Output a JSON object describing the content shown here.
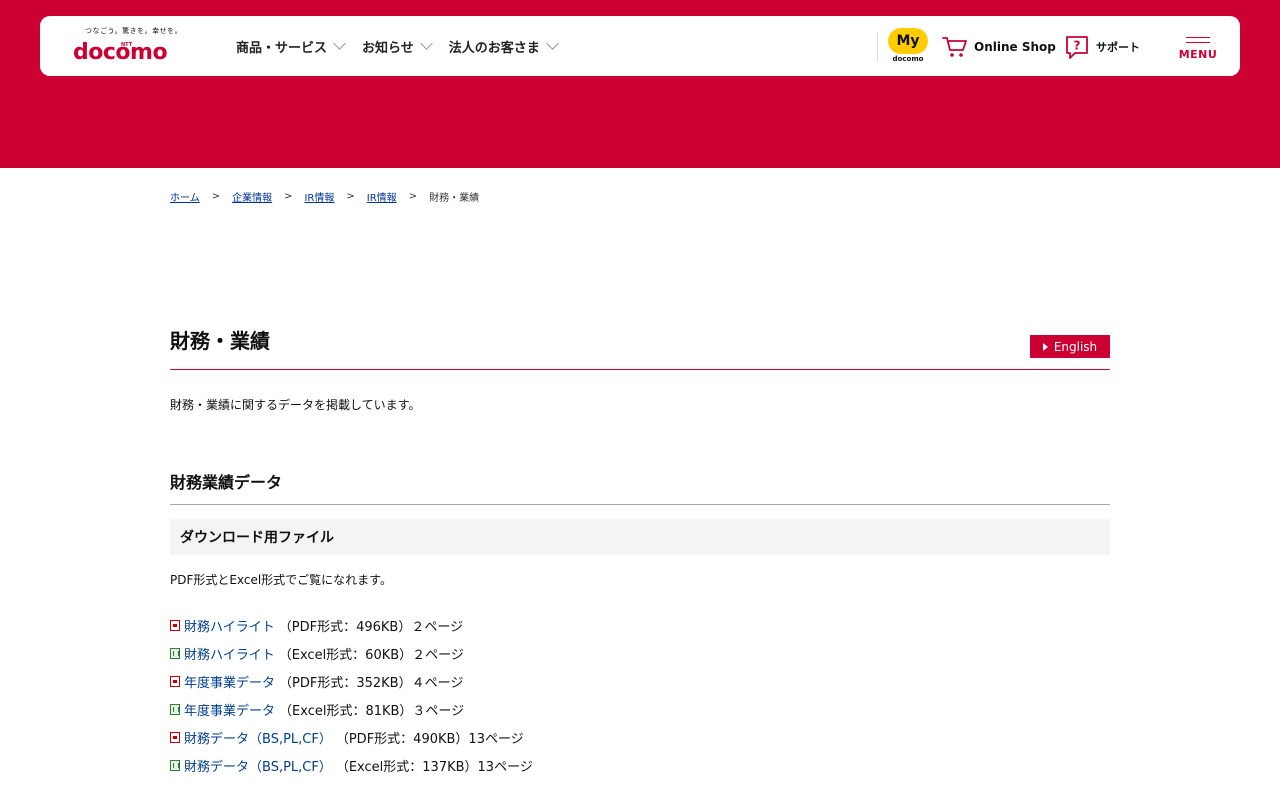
{
  "brand": {
    "tagline": "つなごう。驚きを。幸せを。",
    "ntt": "NTT",
    "wordmark": "docomo",
    "color": "#cc0033"
  },
  "nav": {
    "items": [
      {
        "label": "商品・サービス"
      },
      {
        "label": "お知らせ"
      },
      {
        "label": "法人のお客さま"
      }
    ]
  },
  "header_right": {
    "my_docomo_top": "My",
    "my_docomo_bottom": "docomo",
    "online_shop": "Online Shop",
    "support": "サポート",
    "menu": "MENU"
  },
  "breadcrumb": {
    "items": [
      "ホーム",
      "企業情報",
      "IR情報",
      "IR情報"
    ],
    "separator": ">",
    "current": "財務・業績"
  },
  "page": {
    "title": "財務・業績",
    "english_button": "English",
    "intro": "財務・業績に関するデータを掲載しています。",
    "section_title": "財務業績データ",
    "subsection_title": "ダウンロード用ファイル",
    "formats_note": "PDF形式とExcel形式でご覧になれます。"
  },
  "files": [
    {
      "type": "pdf",
      "icon": "pdf-file-icon",
      "name": "財務ハイライト",
      "meta": "（PDF形式：496KB）２ページ"
    },
    {
      "type": "xls",
      "icon": "excel-file-icon",
      "name": "財務ハイライト",
      "meta": "（Excel形式：60KB）２ページ"
    },
    {
      "type": "pdf",
      "icon": "pdf-file-icon",
      "name": "年度事業データ",
      "meta": "（PDF形式：352KB）４ページ"
    },
    {
      "type": "xls",
      "icon": "excel-file-icon",
      "name": "年度事業データ",
      "meta": "（Excel形式：81KB）３ページ"
    },
    {
      "type": "pdf",
      "icon": "pdf-file-icon",
      "name": "財務データ（BS,PL,CF）",
      "meta": "（PDF形式：490KB）13ページ"
    },
    {
      "type": "xls",
      "icon": "excel-file-icon",
      "name": "財務データ（BS,PL,CF）",
      "meta": "（Excel形式：137KB）13ページ"
    }
  ]
}
